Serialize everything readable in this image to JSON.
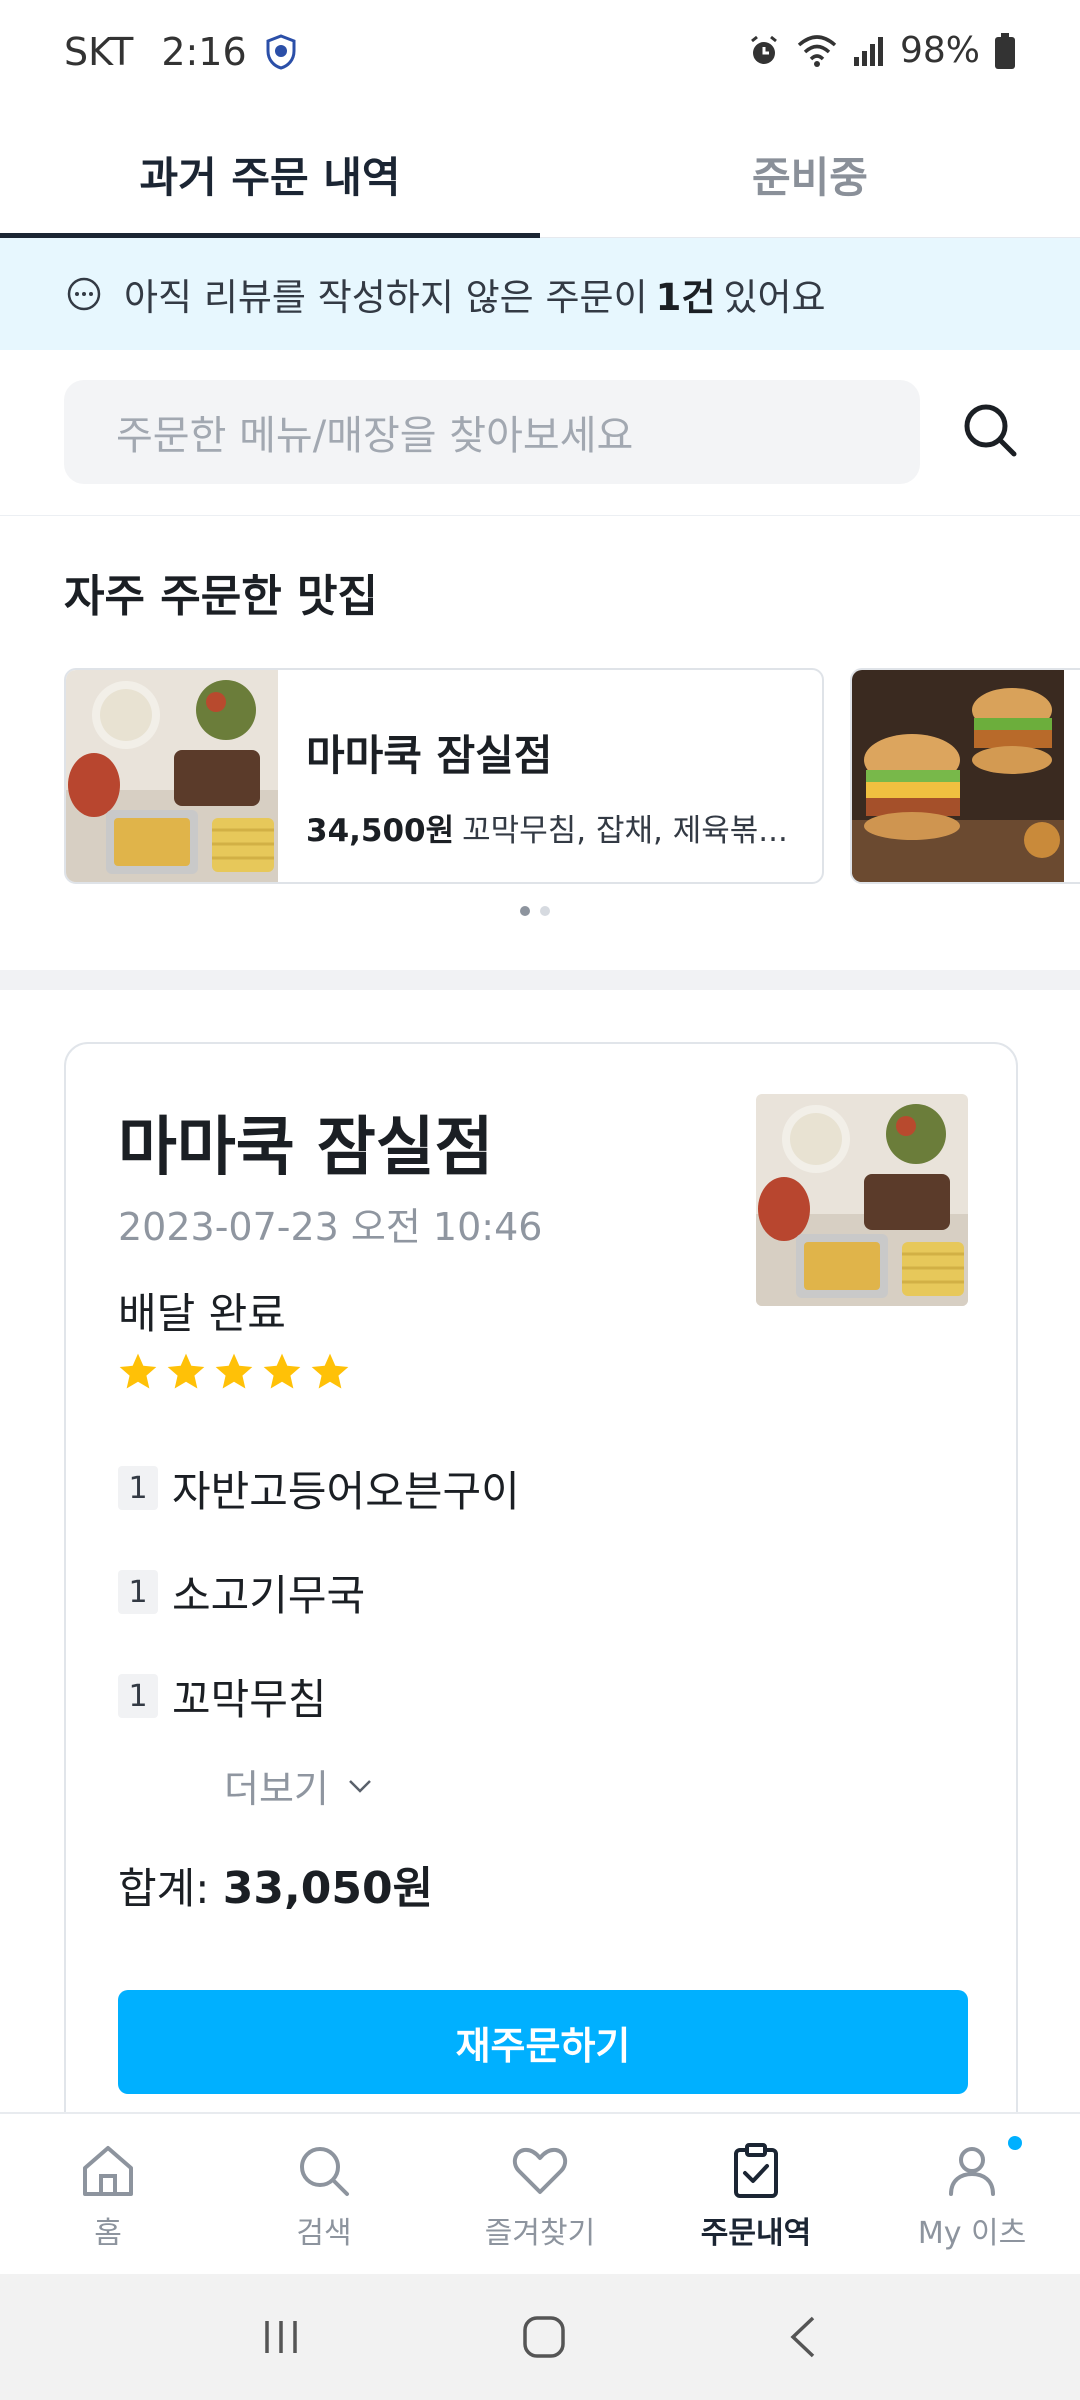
{
  "status_bar": {
    "carrier": "SKT",
    "time": "2:16",
    "battery": "98%"
  },
  "tabs": [
    {
      "label": "과거 주문 내역",
      "active": true
    },
    {
      "label": "준비중",
      "active": false
    }
  ],
  "review_banner": {
    "prefix": "아직 리뷰를 작성하지 않은 주문이",
    "count": "1건",
    "suffix": "있어요"
  },
  "search": {
    "placeholder": "주문한 메뉴/매장을 찾아보세요"
  },
  "frequent": {
    "title": "자주 주문한 맛집",
    "cards": [
      {
        "name": "마마쿡 잠실점",
        "price": "34,500원",
        "menu": "꼬막무침, 잡채, 제육볶..."
      }
    ],
    "page_count": 2,
    "current_page": 1
  },
  "order": {
    "store": "마마쿡 잠실점",
    "date": "2023-07-23 오전 10:46",
    "status": "배달 완료",
    "rating": 5,
    "items": [
      {
        "qty": "1",
        "name": "자반고등어오븐구이"
      },
      {
        "qty": "1",
        "name": "소고기무국"
      },
      {
        "qty": "1",
        "name": "꼬막무침"
      }
    ],
    "more_label": "더보기",
    "total_label": "합계:",
    "total_value": "33,050원",
    "reorder_label": "재주문하기"
  },
  "bottom_nav": [
    {
      "label": "홈",
      "icon": "home-icon"
    },
    {
      "label": "검색",
      "icon": "search-icon"
    },
    {
      "label": "즐겨찾기",
      "icon": "heart-icon"
    },
    {
      "label": "주문내역",
      "icon": "clipboard-check-icon",
      "active": true
    },
    {
      "label": "My 이츠",
      "icon": "person-icon"
    }
  ],
  "colors": {
    "accent": "#00b0ff",
    "banner_bg": "#e7f7fe",
    "star": "#ffc107"
  }
}
